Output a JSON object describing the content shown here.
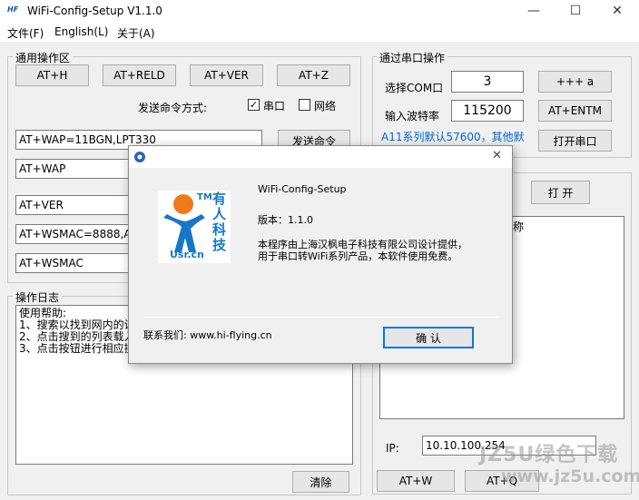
{
  "window": {
    "title": "WiFi-Config-Setup V1.1.0",
    "icon_text": "HF",
    "minimize": "—",
    "maximize": "☐",
    "close": "✕"
  },
  "menu": [
    "文件(F)",
    "English(L)",
    "关于(A)"
  ],
  "general": {
    "title": "通用操作区",
    "buttons": [
      "AT+H",
      "AT+RELD",
      "AT+VER",
      "AT+Z"
    ],
    "send_mode_label": "发送命令方式:",
    "serial_label": "串口",
    "serial_checked": true,
    "network_label": "网络",
    "network_checked": false,
    "commands": [
      "AT+WAP=11BGN,LPT330",
      "AT+WAP",
      "AT+VER",
      "AT+WSMAC=8888,ACCF",
      "AT+WSMAC"
    ],
    "send_button": "发送命令"
  },
  "serial": {
    "title": "通过串口操作",
    "com_label": "选择COM口",
    "com_value": "3",
    "baud_label": "输入波特率",
    "baud_value": "115200",
    "plus_button": "+++ a",
    "entm_button": "AT+ENTM",
    "open_button": "打开串口",
    "note": "A11系列默认57600，其他默"
  },
  "network": {
    "open_button": "打 开",
    "list_header_fragment": "称",
    "ip_label": "IP:",
    "ip_value": "10.10.100.254",
    "atw_button": "AT+W",
    "atq_button": "AT+Q"
  },
  "log": {
    "title": "操作日志",
    "lines": [
      "使用帮助:",
      "1、搜索以找到网内的设",
      "2、点击搜到的列表载入",
      "3、点击按钮进行相应操"
    ],
    "clear_button": "清除"
  },
  "about": {
    "title": "WiFi-Config-Setup",
    "version": "版本：1.1.0",
    "desc_line1": "本程序由上海汉枫电子科技有限公司设计提供，",
    "desc_line2": "用于串口转WiFi系列产品，本软件使用免费。",
    "contact": "联系我们:  www.hi-flying.cn",
    "ok_button": "确 认",
    "close": "✕",
    "logo_tm": "TM",
    "logo_text": [
      "有",
      "人",
      "科",
      "技"
    ],
    "logo_brand": "Usr.cn",
    "colors": {
      "logo_blue": "#1677c9",
      "logo_orange": "#f07a1a"
    }
  },
  "watermark": {
    "line1": "JZ5U绿色下载",
    "line2": "www.jz5u.com"
  }
}
